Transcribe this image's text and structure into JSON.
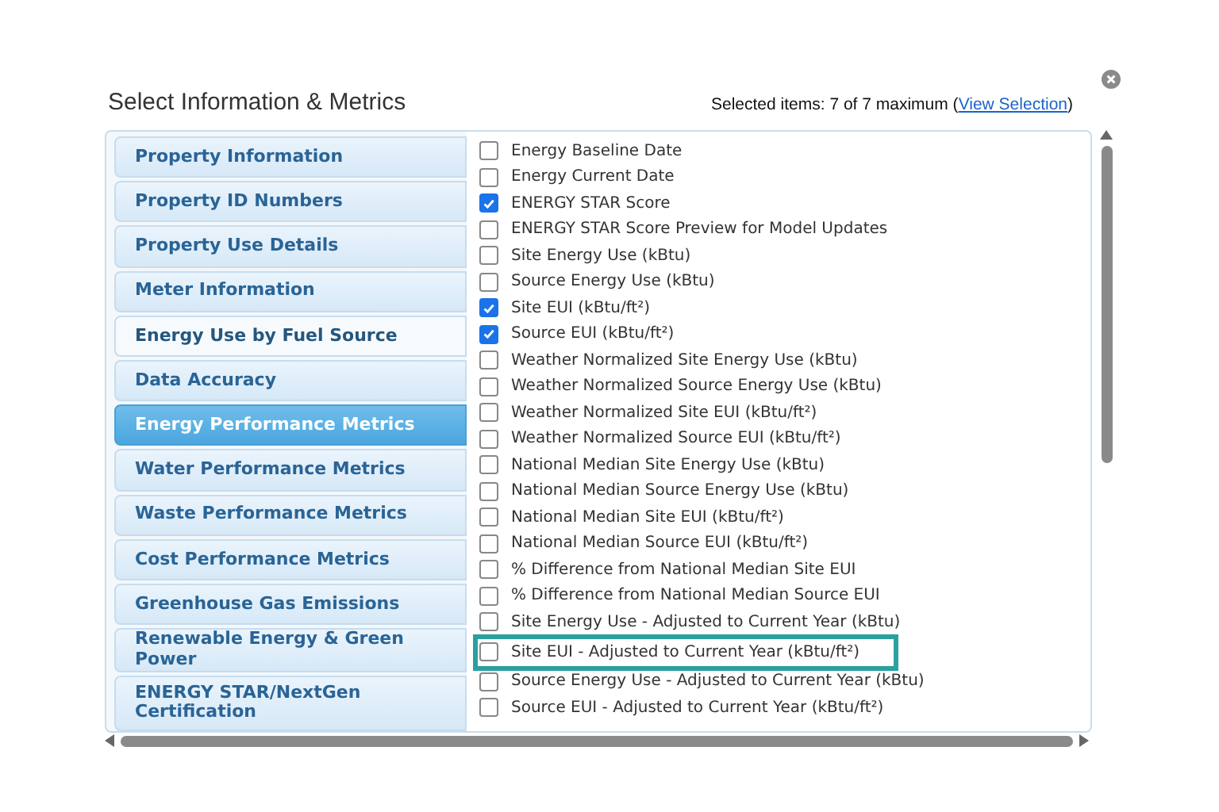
{
  "dialog": {
    "title": "Select Information & Metrics",
    "selection_prefix": "Selected items: 7 of 7 maximum (",
    "selection_link": "View Selection",
    "selection_suffix": ")"
  },
  "categories": [
    {
      "label": "Property Information",
      "selected": false
    },
    {
      "label": "Property ID Numbers",
      "selected": false
    },
    {
      "label": "Property Use Details",
      "selected": false
    },
    {
      "label": "Meter Information",
      "selected": false
    },
    {
      "label": "Energy Use by Fuel Source",
      "selected": false,
      "visited": true
    },
    {
      "label": "Data Accuracy",
      "selected": false
    },
    {
      "label": "Energy Performance Metrics",
      "selected": true
    },
    {
      "label": "Water Performance Metrics",
      "selected": false
    },
    {
      "label": "Waste Performance Metrics",
      "selected": false
    },
    {
      "label": "Cost Performance Metrics",
      "selected": false
    },
    {
      "label": "Greenhouse Gas Emissions",
      "selected": false
    },
    {
      "label": "Renewable Energy & Green Power",
      "selected": false
    },
    {
      "label": "ENERGY STAR/NextGen Certification",
      "selected": false
    }
  ],
  "metrics": [
    {
      "label": "Energy Baseline Date",
      "checked": false,
      "highlighted": false
    },
    {
      "label": "Energy Current Date",
      "checked": false,
      "highlighted": false
    },
    {
      "label": "ENERGY STAR Score",
      "checked": true,
      "highlighted": false
    },
    {
      "label": "ENERGY STAR Score Preview for Model Updates",
      "checked": false,
      "highlighted": false
    },
    {
      "label": "Site Energy Use (kBtu)",
      "checked": false,
      "highlighted": false
    },
    {
      "label": "Source Energy Use (kBtu)",
      "checked": false,
      "highlighted": false
    },
    {
      "label": "Site EUI (kBtu/ft²)",
      "checked": true,
      "highlighted": false
    },
    {
      "label": "Source EUI (kBtu/ft²)",
      "checked": true,
      "highlighted": false
    },
    {
      "label": "Weather Normalized Site Energy Use (kBtu)",
      "checked": false,
      "highlighted": false
    },
    {
      "label": "Weather Normalized Source Energy Use (kBtu)",
      "checked": false,
      "highlighted": false
    },
    {
      "label": "Weather Normalized Site EUI (kBtu/ft²)",
      "checked": false,
      "highlighted": false
    },
    {
      "label": "Weather Normalized Source EUI (kBtu/ft²)",
      "checked": false,
      "highlighted": false
    },
    {
      "label": "National Median Site Energy Use (kBtu)",
      "checked": false,
      "highlighted": false
    },
    {
      "label": "National Median Source Energy Use (kBtu)",
      "checked": false,
      "highlighted": false
    },
    {
      "label": "National Median Site EUI (kBtu/ft²)",
      "checked": false,
      "highlighted": false
    },
    {
      "label": "National Median Source EUI (kBtu/ft²)",
      "checked": false,
      "highlighted": false
    },
    {
      "label": "% Difference from National Median Site EUI",
      "checked": false,
      "highlighted": false
    },
    {
      "label": "% Difference from National Median Source EUI",
      "checked": false,
      "highlighted": false
    },
    {
      "label": "Site Energy Use - Adjusted to Current Year (kBtu)",
      "checked": false,
      "highlighted": false
    },
    {
      "label": "Site EUI - Adjusted to Current Year (kBtu/ft²)",
      "checked": false,
      "highlighted": true
    },
    {
      "label": "Source Energy Use - Adjusted to Current Year (kBtu)",
      "checked": false,
      "highlighted": false
    },
    {
      "label": "Source EUI - Adjusted to Current Year (kBtu/ft²)",
      "checked": false,
      "highlighted": false
    }
  ]
}
